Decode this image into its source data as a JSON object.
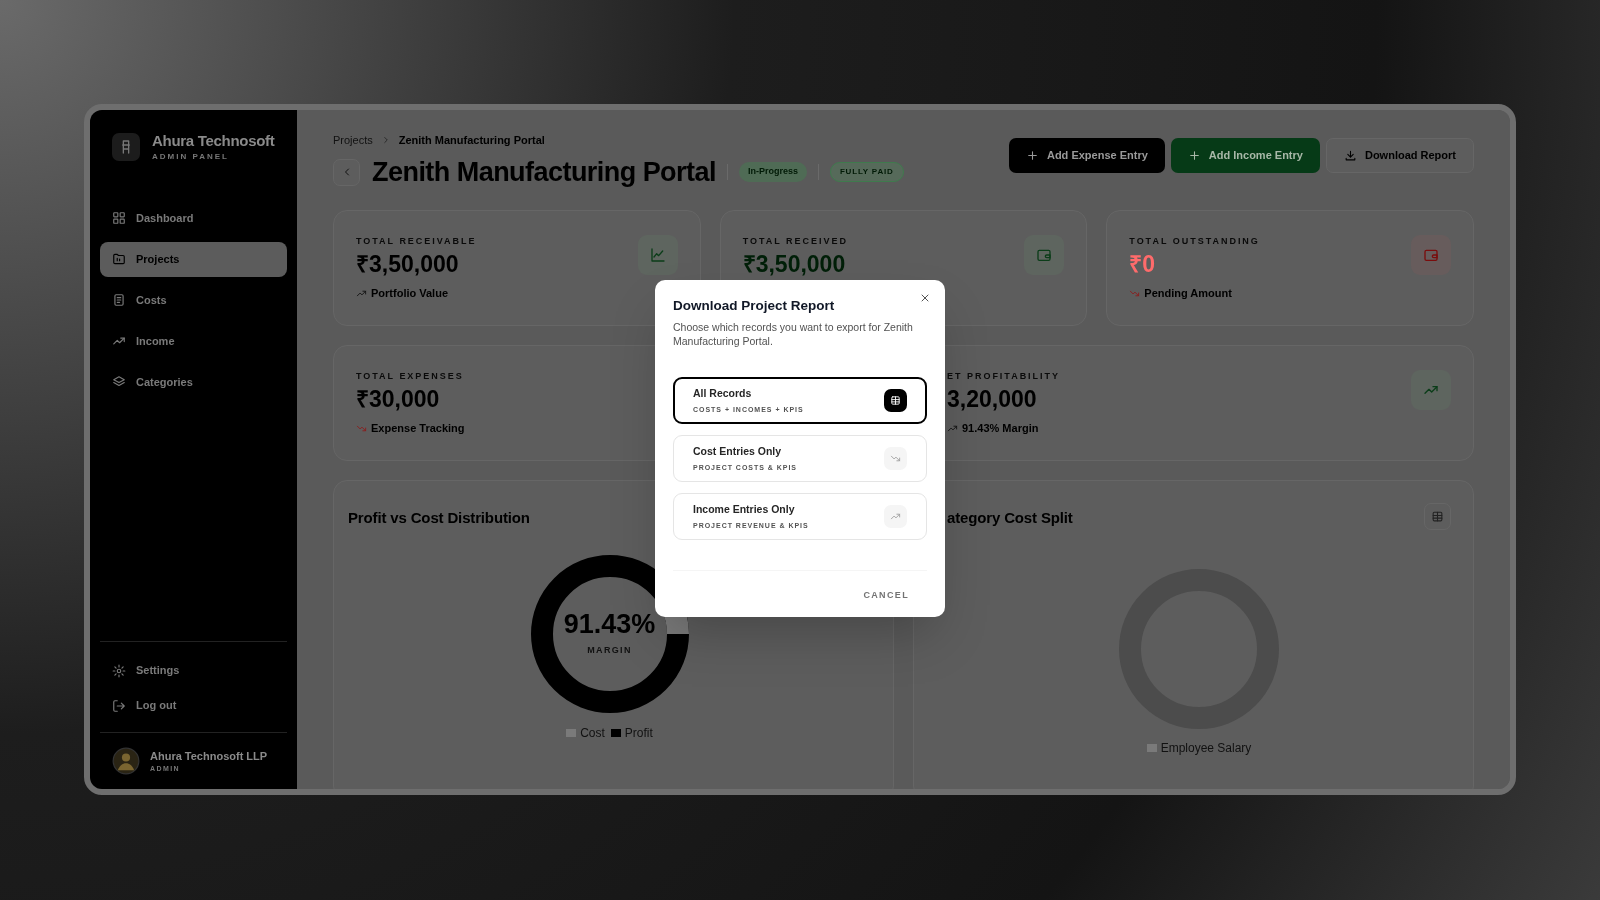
{
  "sidebar": {
    "brand": {
      "name": "Ahura Technosoft",
      "subtitle": "ADMIN PANEL"
    },
    "items": [
      {
        "label": "Dashboard",
        "selected": false
      },
      {
        "label": "Projects",
        "selected": true
      },
      {
        "label": "Costs",
        "selected": false
      },
      {
        "label": "Income",
        "selected": false
      },
      {
        "label": "Categories",
        "selected": false
      }
    ],
    "footer_items": [
      {
        "label": "Settings"
      },
      {
        "label": "Log out"
      }
    ],
    "user": {
      "name": "Ahura Technosoft LLP",
      "role": "ADMIN"
    }
  },
  "breadcrumb": [
    "Projects",
    "Zenith Manufacturing Portal"
  ],
  "title": "Zenith Manufacturing Portal",
  "badges": [
    "In-Progress",
    "FULLY PAID"
  ],
  "actions": [
    "Add Expense Entry",
    "Add Income Entry",
    "Download Report"
  ],
  "stats": [
    {
      "label": "TOTAL RECEIVABLE",
      "value": "₹3,50,000",
      "note": "Portfolio Value"
    },
    {
      "label": "TOTAL RECEIVED",
      "value": "₹3,50,000"
    },
    {
      "label": "TOTAL OUTSTANDING",
      "value": "₹0",
      "note": "Pending Amount"
    },
    {
      "label": "TOTAL EXPENSES",
      "value": "₹30,000",
      "note": "Expense Tracking"
    },
    {
      "label": "ET PROFITABILITY",
      "value": "3,20,000",
      "note": "91.43% Margin"
    }
  ],
  "charts": [
    {
      "title": "Profit vs Cost Distribution",
      "center_value": "91.43%",
      "center_label": "MARGIN",
      "legend": [
        {
          "label": "Cost",
          "color": "#7a7a7a"
        },
        {
          "label": "Profit",
          "color": "#000000"
        }
      ]
    },
    {
      "title": "ategory Cost Split",
      "legend": [
        {
          "label": "Employee Salary",
          "color": "#7a7a7a"
        }
      ]
    }
  ],
  "modal": {
    "title": "Download Project Report",
    "description": "Choose which records you want to export for Zenith Manufacturing Portal.",
    "options": [
      {
        "title": "All Records",
        "subtitle": "COSTS + INCOMES + KPIS",
        "selected": true
      },
      {
        "title": "Cost Entries Only",
        "subtitle": "PROJECT COSTS & KPIS",
        "selected": false
      },
      {
        "title": "Income Entries Only",
        "subtitle": "PROJECT REVENUE & KPIS",
        "selected": false
      }
    ],
    "cancel": "CANCEL"
  }
}
